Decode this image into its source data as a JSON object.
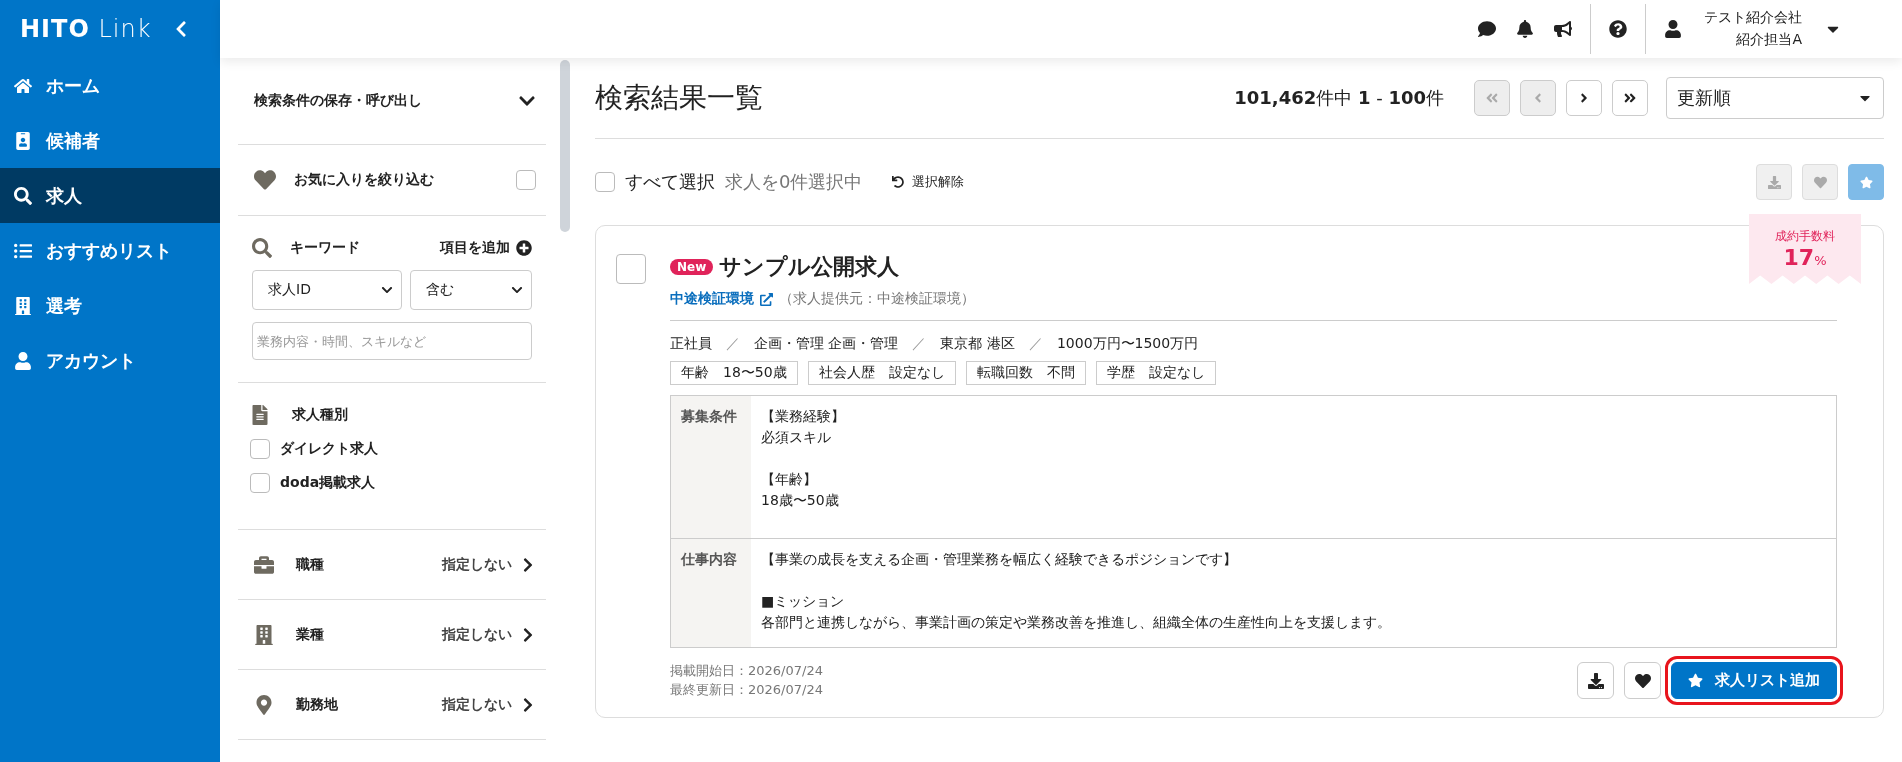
{
  "sidebar": {
    "logo_bold": "HITO",
    "logo_light": "Link",
    "items": [
      {
        "label": "ホーム",
        "selected": false
      },
      {
        "label": "候補者",
        "selected": false
      },
      {
        "label": "求人",
        "selected": true
      },
      {
        "label": "おすすめリスト",
        "selected": false
      },
      {
        "label": "選考",
        "selected": false
      },
      {
        "label": "アカウント",
        "selected": false
      }
    ]
  },
  "topbar": {
    "user": {
      "company": "テスト紹介会社",
      "name": "紹介担当A"
    }
  },
  "filters": {
    "saved_search": {
      "label": "検索条件の保存・呼び出し"
    },
    "favorites": {
      "label": "お気に入りを絞り込む",
      "checked": false
    },
    "keyword": {
      "label": "キーワード",
      "add_label": "項目を追加",
      "field": "求人ID",
      "operator": "含む",
      "placeholder": "業務内容・時間、スキルなど"
    },
    "job_type": {
      "label": "求人種別",
      "options": [
        {
          "label": "ダイレクト求人",
          "checked": false
        },
        {
          "label": "doda掲載求人",
          "checked": false
        }
      ]
    },
    "categories": [
      {
        "label": "職種",
        "value": "指定しない"
      },
      {
        "label": "業種",
        "value": "指定しない"
      },
      {
        "label": "勤務地",
        "value": "指定しない"
      }
    ]
  },
  "results": {
    "title": "検索結果一覧",
    "count": "**101,462**件中 **1** - **100**件",
    "pager": [
      {
        "disabled": true
      },
      {
        "disabled": true
      },
      {
        "disabled": false
      },
      {
        "disabled": false
      }
    ],
    "sort": {
      "value": "更新順"
    },
    "select_all": {
      "label": "すべて選択",
      "checked": false
    },
    "selection_status": "求人を0件選択中",
    "clear_label": "選択解除",
    "bulk_actions": [
      {
        "kind": "plain",
        "disabled": true
      },
      {
        "kind": "plain",
        "disabled": true
      },
      {
        "kind": "primary",
        "disabled": true
      }
    ],
    "jobs": [
      {
        "checked": false,
        "badge": "New",
        "title": "サンプル公開求人",
        "company": "中途検証環境",
        "provider": "（求人提供元：中途検証環境）",
        "meta": [
          "正社員",
          "企画・管理 企画・管理",
          "東京都 港区",
          "1000万円〜1500万円"
        ],
        "tags": [
          {
            "label": "年齢",
            "value": "18〜50歳"
          },
          {
            "label": "社会人歴",
            "value": "設定なし"
          },
          {
            "label": "転職回数",
            "value": "不問"
          },
          {
            "label": "学歴",
            "value": "設定なし"
          }
        ],
        "meta_separator": "／",
        "details": [
          {
            "label": "募集条件",
            "paragraphs": [
              [
                "【業務経験】",
                "必須スキル"
              ],
              [
                "【年齢】",
                "18歳〜50歳"
              ]
            ]
          },
          {
            "label": "仕事内容",
            "paragraphs": [
              [
                "【事業の成長を支える企画・管理業務を幅広く経験できるポジションです】"
              ],
              [
                "■ミッション",
                "各部門と連携しながら、事業計画の策定や業務改善を推進し、組織全体の生産性向上を支援します。"
              ]
            ]
          }
        ],
        "posted": "掲載開始日：2026/07/24",
        "updated": "最終更新日：2026/07/24",
        "fee": {
          "label": "成約手数料",
          "value": "17",
          "unit": "%"
        },
        "actions": [
          {
            "kind": "icon"
          },
          {
            "kind": "icon"
          },
          {
            "kind": "primary",
            "label": "求人リスト追加",
            "highlighted": true
          }
        ]
      }
    ]
  }
}
